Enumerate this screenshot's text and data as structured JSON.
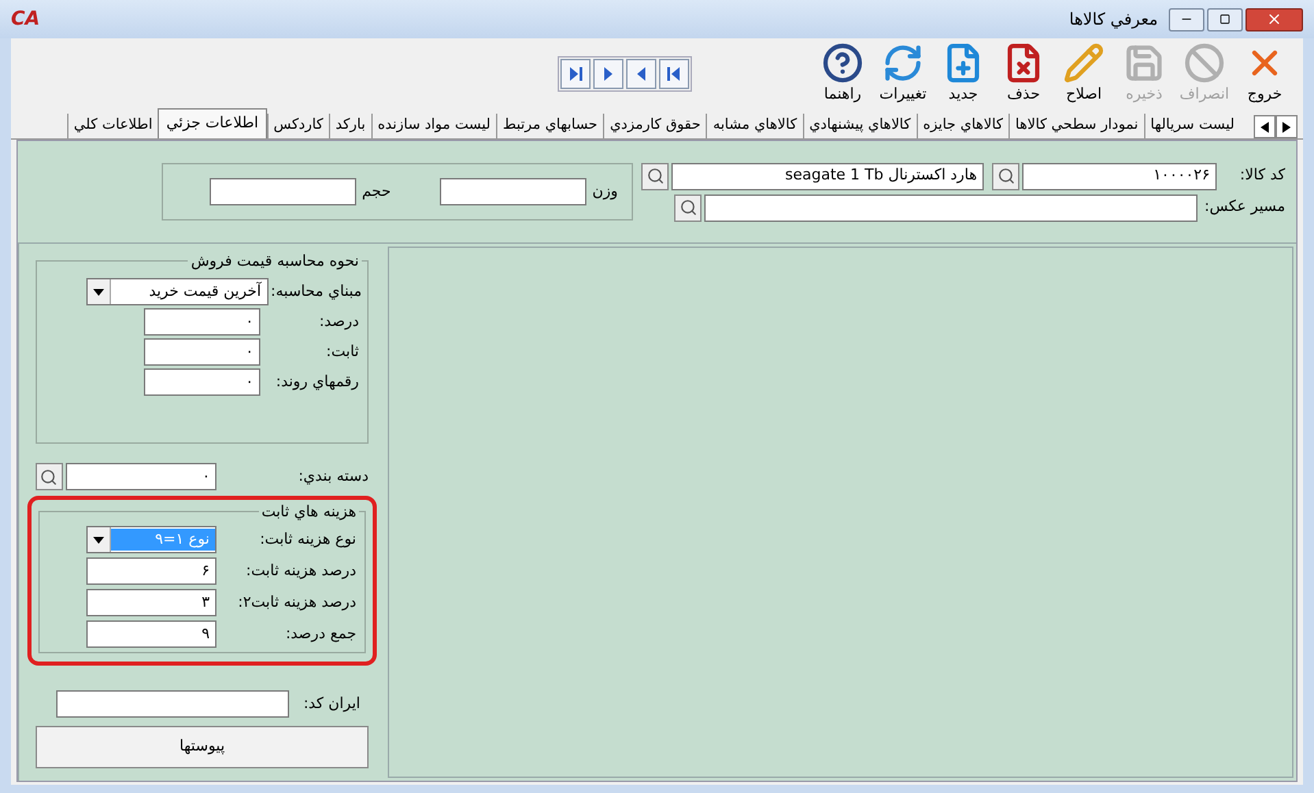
{
  "window": {
    "logo": "CA",
    "title": "معرفي كالاها"
  },
  "toolbar": [
    {
      "kind": "exit",
      "label": "خروج",
      "disabled": false
    },
    {
      "kind": "cancel",
      "label": "انصراف",
      "disabled": true
    },
    {
      "kind": "save",
      "label": "ذخيره",
      "disabled": true
    },
    {
      "kind": "edit",
      "label": "اصلاح",
      "disabled": false
    },
    {
      "kind": "delete",
      "label": "حذف",
      "disabled": false
    },
    {
      "kind": "new",
      "label": "جديد",
      "disabled": false
    },
    {
      "kind": "refresh",
      "label": "تغييرات",
      "disabled": false
    },
    {
      "kind": "help",
      "label": "راهنما",
      "disabled": false
    }
  ],
  "navigation": [
    {
      "kind": "to-end"
    },
    {
      "kind": "forward"
    },
    {
      "kind": "back"
    },
    {
      "kind": "to-start"
    }
  ],
  "tabs": [
    {
      "label": "ليست سريالها",
      "selected": false
    },
    {
      "label": "نمودار سطحي كالاها",
      "selected": false
    },
    {
      "label": "كالاهاي جايزه",
      "selected": false
    },
    {
      "label": "كالاهاي پيشنهادي",
      "selected": false
    },
    {
      "label": "كالاهاي مشابه",
      "selected": false
    },
    {
      "label": "حقوق كارمزدي",
      "selected": false
    },
    {
      "label": "حسابهاي مرتبط",
      "selected": false
    },
    {
      "label": "ليست مواد سازنده",
      "selected": false
    },
    {
      "label": "باركد",
      "selected": false
    },
    {
      "label": "كاردكس",
      "selected": false
    },
    {
      "label": "اطلاعات جزئي",
      "selected": true
    },
    {
      "label": "اطلاعات كلي",
      "selected": false
    }
  ],
  "header": {
    "code_label": "كد كالا:",
    "code": "۱۰۰۰۰۲۶",
    "name": "هارد اکسترنال seagate 1 Tb",
    "image_path_label": "مسير عكس:",
    "weight_label": "وزن",
    "volume_label": "حجم"
  },
  "price_group": {
    "title": "نحوه محاسبه قيمت فروش",
    "basis_label": "مبناي محاسبه:",
    "basis": "آخرين قيمت خريد",
    "fields": [
      {
        "label": "درصد:",
        "value": "۰"
      },
      {
        "label": "ثابت:",
        "value": "۰"
      },
      {
        "label": "رقمهاي روند:",
        "value": "۰"
      }
    ]
  },
  "category": {
    "label": "دسته بندي:",
    "value": "۰"
  },
  "fixed_costs": {
    "title": "هزينه هاي ثابت",
    "highlighted": true,
    "type_label": "نوع هزينه ثابت:",
    "type": "نوع ۱=۹",
    "fields": [
      {
        "label": "درصد هزينه ثابت:",
        "value": "۶"
      },
      {
        "label": "درصد هزينه ثابت۲:",
        "value": "۳"
      },
      {
        "label": "جمع درصد:",
        "value": "۹"
      }
    ]
  },
  "iran_code": {
    "label": "ايران كد:"
  },
  "attachments_button": "پيوستها"
}
